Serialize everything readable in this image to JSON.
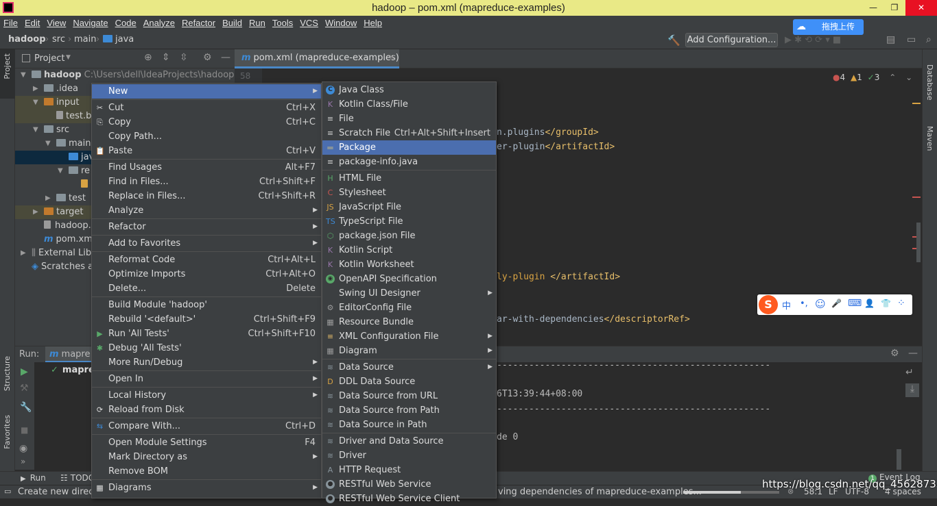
{
  "window": {
    "title": "hadoop – pom.xml (mapreduce-examples)",
    "minimize": "—",
    "restore": "❐",
    "close": "✕"
  },
  "menubar": [
    "File",
    "Edit",
    "View",
    "Navigate",
    "Code",
    "Analyze",
    "Refactor",
    "Build",
    "Run",
    "Tools",
    "VCS",
    "Window",
    "Help"
  ],
  "breadcrumb": {
    "project": "hadoop",
    "src": "src",
    "main": "main",
    "java": "java"
  },
  "toolbar": {
    "add_configuration": "Add Configuration...",
    "upload": "拖拽上传"
  },
  "side": {
    "project": "Project",
    "structure": "Structure",
    "favorites": "Favorites",
    "database": "Database",
    "maven": "Maven"
  },
  "project_panel": {
    "title": "Project"
  },
  "tree": [
    {
      "label": "hadoop",
      "path": "C:\\Users\\dell\\IdeaProjects\\hadoop"
    },
    {
      "label": ".idea"
    },
    {
      "label": "input"
    },
    {
      "label": "test.b"
    },
    {
      "label": "src"
    },
    {
      "label": "main"
    },
    {
      "label": "java"
    },
    {
      "label": "re"
    },
    {
      "label": ""
    },
    {
      "label": "test"
    },
    {
      "label": "target"
    },
    {
      "label": "hadoop."
    },
    {
      "label": "pom.xml"
    },
    {
      "label": "External Lib"
    },
    {
      "label": "Scratches a"
    }
  ],
  "editor": {
    "tab": "pom.xml (mapreduce-examples)",
    "line_number": "58",
    "errors": "4",
    "warnings": "1",
    "ok": "3",
    "lines": [
      {
        "a": "n.plugins",
        "b": "</groupId>"
      },
      {
        "a": "er-plugin",
        "b": "</artifactId>"
      },
      {
        "a": "ly-plugin ",
        "b": "</artifactId>"
      },
      {
        "a": "ar-with-dependencies",
        "b": "</descriptorRef>"
      }
    ]
  },
  "run": {
    "label": "Run:",
    "tab": "mapre",
    "item": "mapre",
    "out": [
      "6T13:39:44+08:00",
      "de 0"
    ],
    "dashes": "--------------------------------------------------------------------------------"
  },
  "bottom_tabs": {
    "run": "Run",
    "todo": "TODO",
    "event_log": "Event Log"
  },
  "status": {
    "left": "Create new directo",
    "center": "ving dependencies of mapreduce-examples...",
    "pos": "58:1",
    "lf": "LF",
    "enc": "UTF-8",
    "indent": "4 spaces",
    "watermark": "https://blog.csdn.net/qq_45628733"
  },
  "context_menu": [
    {
      "label": "New",
      "sub": true,
      "sel": true
    },
    {
      "sep": true
    },
    {
      "label": "Cut",
      "sc": "Ctrl+X",
      "icon": "✂"
    },
    {
      "label": "Copy",
      "sc": "Ctrl+C",
      "icon": "⎘"
    },
    {
      "label": "Copy Path..."
    },
    {
      "label": "Paste",
      "sc": "Ctrl+V",
      "icon": "📋"
    },
    {
      "sep": true
    },
    {
      "label": "Find Usages",
      "sc": "Alt+F7"
    },
    {
      "label": "Find in Files...",
      "sc": "Ctrl+Shift+F"
    },
    {
      "label": "Replace in Files...",
      "sc": "Ctrl+Shift+R"
    },
    {
      "label": "Analyze",
      "sub": true
    },
    {
      "sep": true
    },
    {
      "label": "Refactor",
      "sub": true
    },
    {
      "sep": true
    },
    {
      "label": "Add to Favorites",
      "sub": true
    },
    {
      "sep": true
    },
    {
      "label": "Reformat Code",
      "sc": "Ctrl+Alt+L"
    },
    {
      "label": "Optimize Imports",
      "sc": "Ctrl+Alt+O"
    },
    {
      "label": "Delete...",
      "sc": "Delete"
    },
    {
      "sep": true
    },
    {
      "label": "Build Module 'hadoop'"
    },
    {
      "label": "Rebuild '<default>'",
      "sc": "Ctrl+Shift+F9"
    },
    {
      "label": "Run 'All Tests'",
      "sc": "Ctrl+Shift+F10",
      "icon": "▶",
      "color": "#59a869"
    },
    {
      "label": "Debug 'All Tests'",
      "icon": "✱",
      "color": "#59a869"
    },
    {
      "label": "More Run/Debug",
      "sub": true
    },
    {
      "sep": true
    },
    {
      "label": "Open In",
      "sub": true
    },
    {
      "sep": true
    },
    {
      "label": "Local History",
      "sub": true
    },
    {
      "label": "Reload from Disk",
      "icon": "⟳"
    },
    {
      "sep": true
    },
    {
      "label": "Compare With...",
      "sc": "Ctrl+D",
      "icon": "⇆",
      "color": "#3d8ad6"
    },
    {
      "sep": true
    },
    {
      "label": "Open Module Settings",
      "sc": "F4"
    },
    {
      "label": "Mark Directory as",
      "sub": true
    },
    {
      "label": "Remove BOM"
    },
    {
      "sep": true
    },
    {
      "label": "Diagrams",
      "sub": true,
      "icon": "▦"
    }
  ],
  "new_menu": [
    {
      "label": "Java Class",
      "icon": "C",
      "color": "#3d8ad6",
      "round": true
    },
    {
      "label": "Kotlin Class/File",
      "icon": "K",
      "color": "#9876aa"
    },
    {
      "label": "File",
      "icon": "≡",
      "color": "#cfcfcf"
    },
    {
      "label": "Scratch File",
      "sc": "Ctrl+Alt+Shift+Insert",
      "icon": "≡",
      "color": "#cfcfcf"
    },
    {
      "label": "Package",
      "icon": "▬",
      "color": "#87939a",
      "sel": true
    },
    {
      "label": "package-info.java",
      "icon": "≡",
      "color": "#cfcfcf"
    },
    {
      "sep": true
    },
    {
      "label": "HTML File",
      "icon": "H",
      "color": "#59a869"
    },
    {
      "label": "Stylesheet",
      "icon": "C",
      "color": "#c75450"
    },
    {
      "label": "JavaScript File",
      "icon": "JS",
      "color": "#d9a343"
    },
    {
      "label": "TypeScript File",
      "icon": "TS",
      "color": "#3d8ad6"
    },
    {
      "label": "package.json File",
      "icon": "⬡",
      "color": "#59a869"
    },
    {
      "label": "Kotlin Script",
      "icon": "K",
      "color": "#9876aa"
    },
    {
      "label": "Kotlin Worksheet",
      "icon": "K",
      "color": "#9876aa"
    },
    {
      "label": "OpenAPI Specification",
      "icon": "◉",
      "color": "#59a869",
      "round": true
    },
    {
      "label": "Swing UI Designer",
      "sub": true
    },
    {
      "label": "EditorConfig File",
      "icon": "⚙",
      "color": "#9a9a9a"
    },
    {
      "label": "Resource Bundle",
      "icon": "▦",
      "color": "#9a9a9a"
    },
    {
      "label": "XML Configuration File",
      "sub": true,
      "icon": "≡",
      "color": "#e8bf6a"
    },
    {
      "label": "Diagram",
      "sub": true,
      "icon": "▦",
      "color": "#9a9a9a"
    },
    {
      "sep": true
    },
    {
      "label": "Data Source",
      "sub": true,
      "icon": "≋",
      "color": "#87939a"
    },
    {
      "label": "DDL Data Source",
      "icon": "D",
      "color": "#d9a343"
    },
    {
      "label": "Data Source from URL",
      "icon": "≋",
      "color": "#87939a"
    },
    {
      "label": "Data Source from Path",
      "icon": "≋",
      "color": "#87939a"
    },
    {
      "label": "Data Source in Path",
      "icon": "≋",
      "color": "#87939a"
    },
    {
      "sep": true
    },
    {
      "label": "Driver and Data Source",
      "icon": "≋",
      "color": "#87939a"
    },
    {
      "label": "Driver",
      "icon": "≋",
      "color": "#87939a"
    },
    {
      "label": "HTTP Request",
      "icon": "A",
      "color": "#87939a"
    },
    {
      "label": "RESTful Web Service",
      "icon": "●",
      "color": "#87939a",
      "round": true
    },
    {
      "label": "RESTful Web Service Client",
      "icon": "●",
      "color": "#87939a",
      "round": true
    }
  ],
  "ime": {
    "logo": "S",
    "items": [
      "中",
      "•,",
      "☺",
      "🎤",
      "⌨",
      "👤",
      "👕",
      "⁘"
    ]
  }
}
